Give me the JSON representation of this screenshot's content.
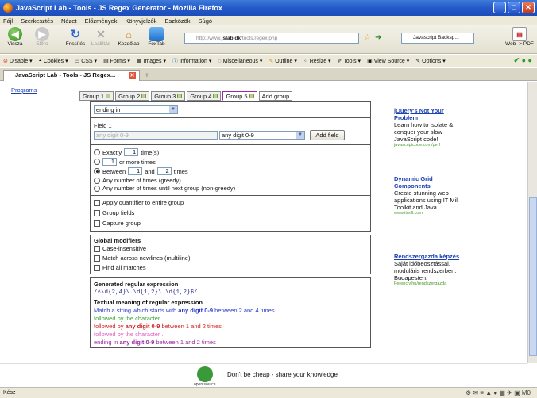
{
  "window": {
    "title": "JavaScript Lab - Tools - JS Regex Generator - Mozilla Firefox"
  },
  "menu": [
    "Fájl",
    "Szerkesztés",
    "Nézet",
    "Előzmények",
    "Könyvjelzők",
    "Eszközök",
    "Súgó"
  ],
  "nav": {
    "back": "Vissza",
    "forward": "Előre",
    "reload": "Frissítés",
    "stop": "Leállítás",
    "home": "Kezdőlap",
    "foxtab": "FoxTab",
    "url_prefix": "http://www.",
    "url_domain": "jslab.dk",
    "url_path": "/tools.regex.php",
    "search": "Javascript Backsp...",
    "webpdf": "Web -> PDF"
  },
  "devbar": [
    "Disable",
    "Cookies",
    "CSS",
    "Forms",
    "Images",
    "Information",
    "Miscellaneous",
    "Outline",
    "Resize",
    "Tools",
    "View Source",
    "Options"
  ],
  "tab": {
    "title": "JavaScript Lab - Tools - JS Regex..."
  },
  "left": {
    "programs": "Programs"
  },
  "groups": [
    "Group 1",
    "Group 2",
    "Group 3",
    "Group 4",
    "Group 5",
    "Add group"
  ],
  "editor": {
    "position": "ending in",
    "field_label": "Field 1",
    "field_value": "any digit 0-9",
    "field_select": "any digit 0-9",
    "add_field": "Add field",
    "exactly_label": "Exactly",
    "exactly_val": "1",
    "exactly_suffix": "time(s)",
    "more_val": "1",
    "more_suffix": "or more times",
    "between_label": "Between",
    "between_min": "1",
    "between_and": "and",
    "between_max": "2",
    "between_suffix": "times",
    "greedy": "Any number of times (greedy)",
    "nongreedy": "Any number of times until next group (non-greedy)",
    "apply_q": "Apply quantifier to entire group",
    "group_fields": "Group fields",
    "capture": "Capture group"
  },
  "global": {
    "title": "Global modifiers",
    "case": "Case-insensitive",
    "multiline": "Match across newlines (multiline)",
    "all": "Find all matches"
  },
  "output": {
    "title": "Generated regular expression",
    "regex": "/^\\d{2,4}\\.\\d{1,2}\\.\\d{1,2}$/",
    "meaning_title": "Textual meaning of regular expression",
    "lines": [
      {
        "pre": "Match a string which starts with ",
        "bold": "any digit 0-9",
        "post": " between 2 and 4 times",
        "color": "#2b3bd0"
      },
      {
        "pre": "followed by the character .",
        "bold": "",
        "post": "",
        "color": "#3aa535"
      },
      {
        "pre": "followed by ",
        "bold": "any digit 0-9",
        "post": " between 1 and 2 times",
        "color": "#d02020"
      },
      {
        "pre": "followed by the character .",
        "bold": "",
        "post": "",
        "color": "#e060c0"
      },
      {
        "pre": "ending in ",
        "bold": "any digit 0-9",
        "post": " between 1 and 2 times",
        "color": "#9c2aa0"
      }
    ]
  },
  "ads": [
    {
      "title": "jQuery's Not Your Problem",
      "desc": "Learn how to isolate & conquer your slow JavaScript code!",
      "url": "javascriptcode.com/perf"
    },
    {
      "title": "Dynamic Grid Components",
      "desc": "Create stunning web applications using IT Mill Toolkit and Java.",
      "url": "www.itmill.com"
    },
    {
      "title": "Rendszergazda képzés",
      "desc": "Saját időbeosztással, moduláris rendszerben. Budapesten.",
      "url": "Ferenciv.hu/rendszergazda"
    }
  ],
  "footer": {
    "logo_text": "open source",
    "tagline": "Don't be cheap - share your knowledge"
  },
  "status": {
    "text": "Kész"
  }
}
